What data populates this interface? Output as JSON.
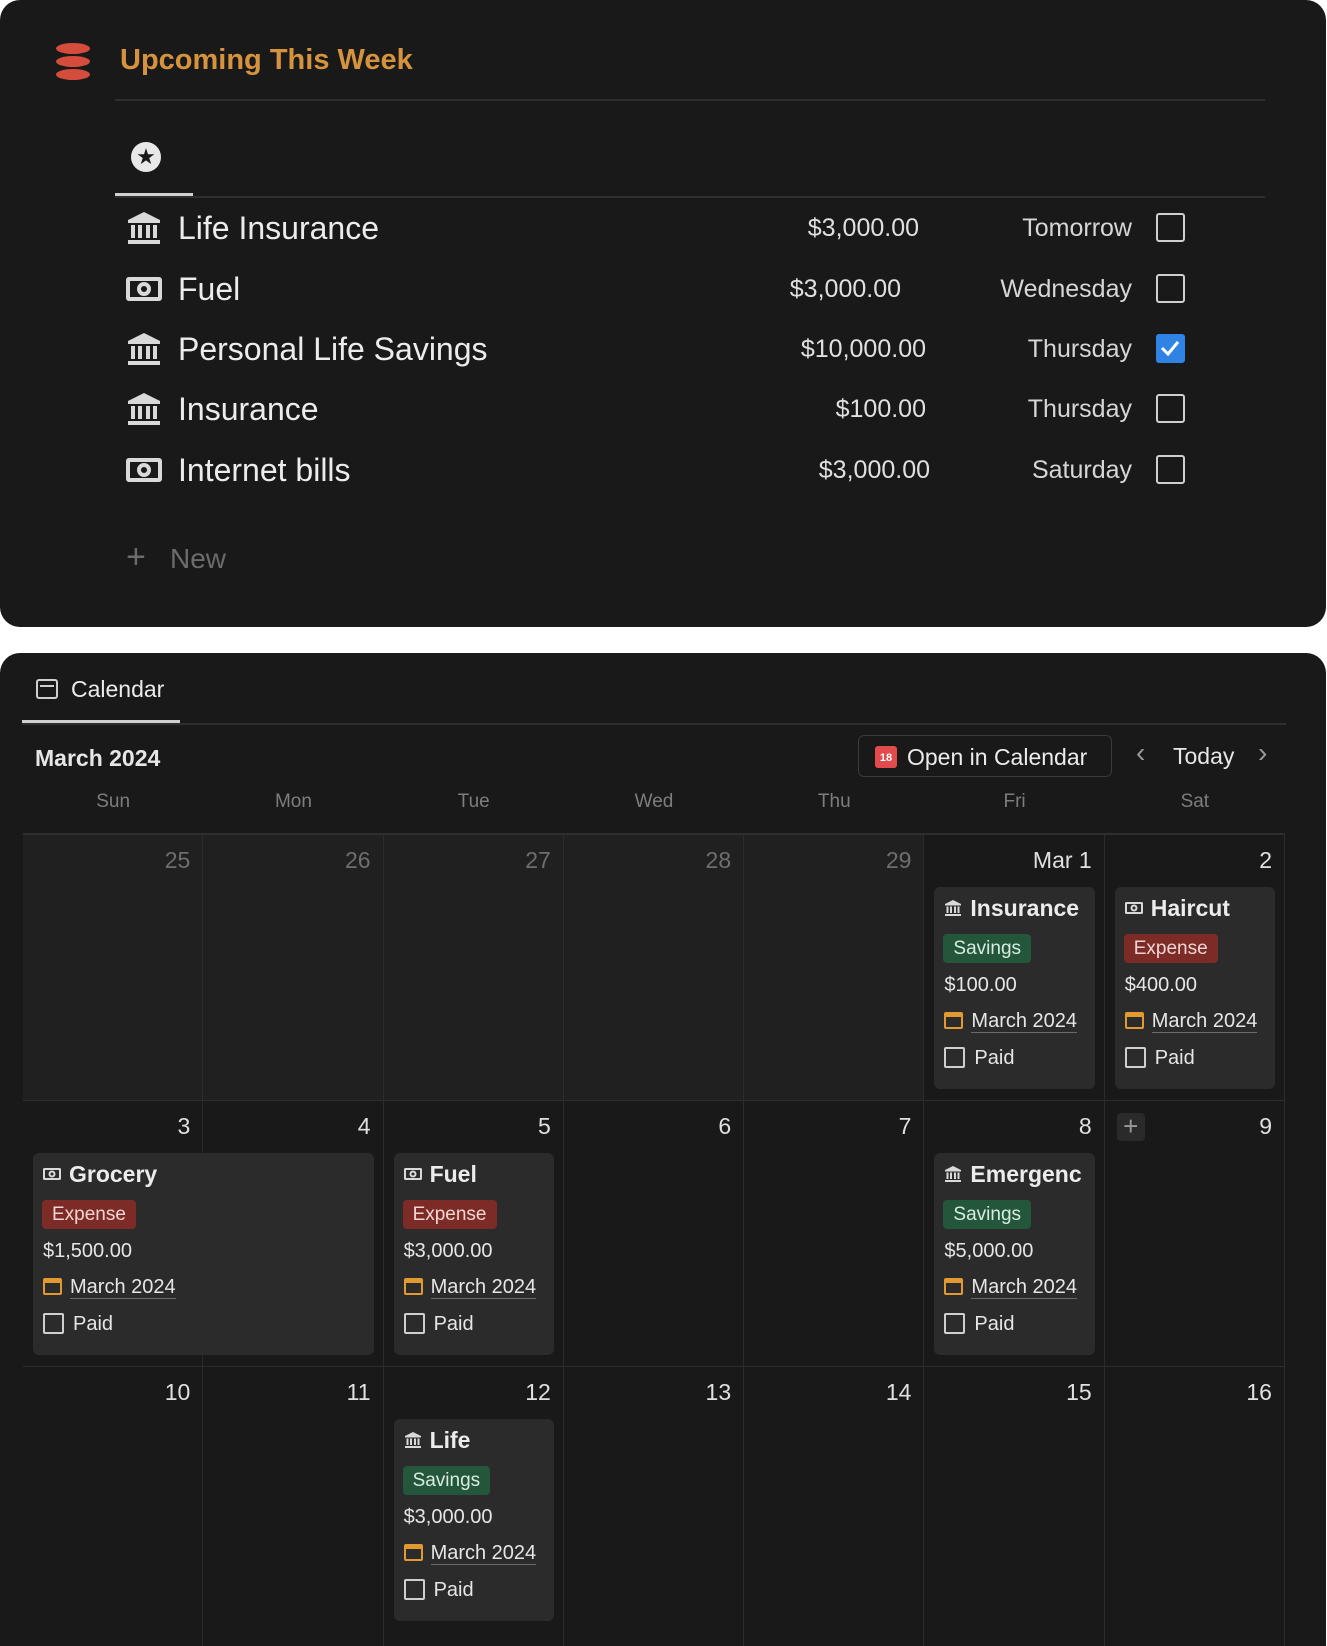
{
  "upcoming": {
    "title": "Upcoming This Week",
    "header_icon": "database-icon",
    "view_icon": "star-badge-icon",
    "rows": [
      {
        "icon": "bank-icon",
        "name": "Life Insurance",
        "amount": "$3,000.00",
        "day": "Tomorrow",
        "paid": false
      },
      {
        "icon": "cash-icon",
        "name": "Fuel",
        "amount": "$3,000.00",
        "day": "Wednesday",
        "paid": false
      },
      {
        "icon": "bank-icon",
        "name": "Personal Life Savings",
        "amount": "$10,000.00",
        "day": "Thursday",
        "paid": true
      },
      {
        "icon": "bank-icon",
        "name": "Insurance",
        "amount": "$100.00",
        "day": "Thursday",
        "paid": false
      },
      {
        "icon": "cash-icon",
        "name": "Internet bills",
        "amount": "$3,000.00",
        "day": "Saturday",
        "paid": false
      }
    ],
    "new_label": "New"
  },
  "calendar": {
    "tab_label": "Calendar",
    "month": "March 2024",
    "open_button": "Open in Calendar",
    "open_icon_text": "18",
    "today_label": "Today",
    "weekdays": [
      "Sun",
      "Mon",
      "Tue",
      "Wed",
      "Thu",
      "Fri",
      "Sat"
    ],
    "weeks": [
      [
        "25",
        "26",
        "27",
        "28",
        "29",
        "Mar 1",
        "2"
      ],
      [
        "3",
        "4",
        "5",
        "6",
        "7",
        "8",
        "9"
      ],
      [
        "10",
        "11",
        "12",
        "13",
        "14",
        "15",
        "16"
      ]
    ],
    "events": [
      {
        "week": 0,
        "day": 5,
        "span": 1,
        "icon": "bank-icon",
        "title": "Insurance",
        "tag": "Savings",
        "amount": "$100.00",
        "date": "March 2024",
        "paid_label": "Paid"
      },
      {
        "week": 0,
        "day": 6,
        "span": 1,
        "icon": "cash-icon",
        "title": "Haircut",
        "tag": "Expense",
        "amount": "$400.00",
        "date": "March 2024",
        "paid_label": "Paid"
      },
      {
        "week": 1,
        "day": 0,
        "span": 2,
        "icon": "cash-icon",
        "title": "Grocery",
        "tag": "Expense",
        "amount": "$1,500.00",
        "date": "March 2024",
        "paid_label": "Paid"
      },
      {
        "week": 1,
        "day": 2,
        "span": 1,
        "icon": "cash-icon",
        "title": "Fuel",
        "tag": "Expense",
        "amount": "$3,000.00",
        "date": "March 2024",
        "paid_label": "Paid"
      },
      {
        "week": 1,
        "day": 5,
        "span": 1,
        "icon": "bank-icon",
        "title": "Emergenc",
        "tag": "Savings",
        "amount": "$5,000.00",
        "date": "March 2024",
        "paid_label": "Paid"
      },
      {
        "week": 2,
        "day": 2,
        "span": 1,
        "icon": "bank-icon",
        "title": "Life",
        "tag": "Savings",
        "amount": "$3,000.00",
        "date": "March 2024",
        "paid_label": "Paid"
      }
    ]
  },
  "colors": {
    "panel_bg": "#191919",
    "title_accent": "#d6933e",
    "database_icon": "#d44c3c",
    "checkbox_checked": "#2f83e5",
    "savings_tag": "#24563b",
    "expense_tag": "#7d2b26",
    "date_icon": "#e2992f"
  }
}
